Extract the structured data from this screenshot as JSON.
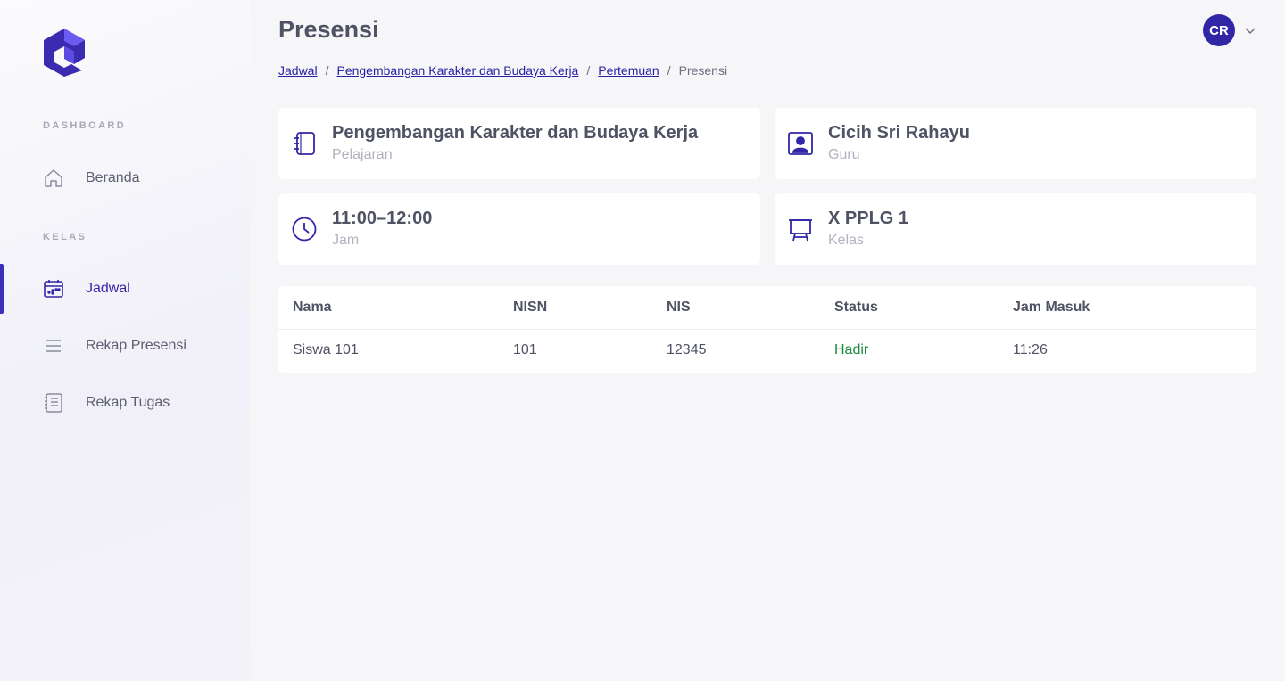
{
  "colors": {
    "accent": "#3126a6",
    "status_hadir": "#1b8a3e",
    "muted": "#b0b2bf"
  },
  "sidebar": {
    "logo_icon": "app-logo-icon",
    "sections": [
      {
        "label": "DASHBOARD"
      },
      {
        "label": "KELAS"
      }
    ],
    "items": [
      {
        "label": "Beranda",
        "icon": "home-icon",
        "active": false
      },
      {
        "label": "Jadwal",
        "icon": "calendar-icon",
        "active": true
      },
      {
        "label": "Rekap Presensi",
        "icon": "list-icon",
        "active": false
      },
      {
        "label": "Rekap Tugas",
        "icon": "document-icon",
        "active": false
      }
    ]
  },
  "header": {
    "title": "Presensi",
    "breadcrumb": [
      {
        "label": "Jadwal"
      },
      {
        "label": "Pengembangan Karakter dan Budaya Kerja"
      },
      {
        "label": "Pertemuan"
      },
      {
        "label": "Presensi"
      }
    ],
    "separator": "/",
    "user": {
      "initials": "CR"
    }
  },
  "cards": [
    {
      "title": "Pengembangan Karakter dan Budaya Kerja",
      "subtitle": "Pelajaran",
      "icon": "notebook-icon"
    },
    {
      "title": "Cicih Sri Rahayu",
      "subtitle": "Guru",
      "icon": "teacher-icon"
    },
    {
      "title": "11:00–12:00",
      "subtitle": "Jam",
      "icon": "clock-icon"
    },
    {
      "title": "X PPLG 1",
      "subtitle": "Kelas",
      "icon": "easel-icon"
    }
  ],
  "table": {
    "headers": [
      "Nama",
      "NISN",
      "NIS",
      "Status",
      "Jam Masuk"
    ],
    "rows": [
      [
        "Siswa 101",
        "101",
        "12345",
        "Hadir",
        "11:26"
      ]
    ]
  }
}
